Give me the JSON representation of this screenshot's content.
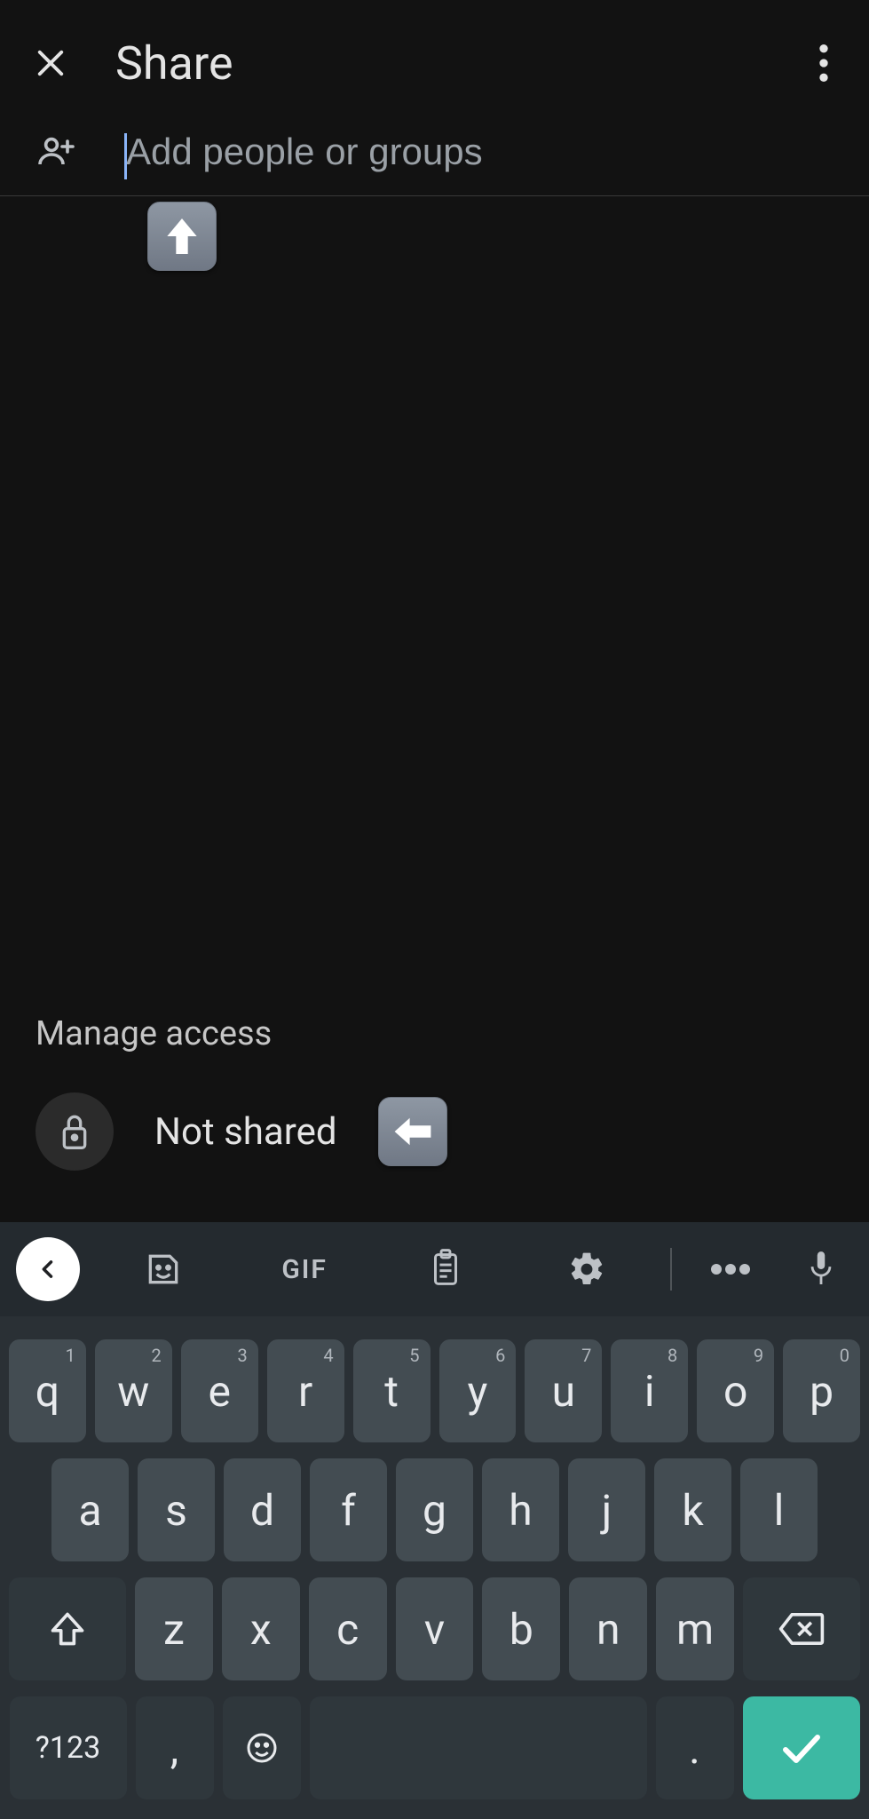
{
  "header": {
    "title": "Share",
    "close_icon": "close",
    "more_icon": "more"
  },
  "add_people": {
    "placeholder": "Add people or groups",
    "value": ""
  },
  "manage": {
    "title": "Manage access",
    "status": "Not shared"
  },
  "keyboard": {
    "toolbar": {
      "collapse": "<",
      "sticker": "sticker",
      "gif": "GIF",
      "clipboard": "clipboard",
      "settings": "settings",
      "more": "more",
      "mic": "mic"
    },
    "rows": [
      [
        {
          "k": "q",
          "h": "1"
        },
        {
          "k": "w",
          "h": "2"
        },
        {
          "k": "e",
          "h": "3"
        },
        {
          "k": "r",
          "h": "4"
        },
        {
          "k": "t",
          "h": "5"
        },
        {
          "k": "y",
          "h": "6"
        },
        {
          "k": "u",
          "h": "7"
        },
        {
          "k": "i",
          "h": "8"
        },
        {
          "k": "o",
          "h": "9"
        },
        {
          "k": "p",
          "h": "0"
        }
      ],
      [
        {
          "k": "a"
        },
        {
          "k": "s"
        },
        {
          "k": "d"
        },
        {
          "k": "f"
        },
        {
          "k": "g"
        },
        {
          "k": "h"
        },
        {
          "k": "j"
        },
        {
          "k": "k"
        },
        {
          "k": "l"
        }
      ],
      [
        {
          "k": "z"
        },
        {
          "k": "x"
        },
        {
          "k": "c"
        },
        {
          "k": "v"
        },
        {
          "k": "b"
        },
        {
          "k": "n"
        },
        {
          "k": "m"
        }
      ]
    ],
    "mode_key": "?123",
    "comma_key": ",",
    "period_key": "."
  },
  "annotations": {
    "up": "up-arrow",
    "left": "left-arrow"
  }
}
